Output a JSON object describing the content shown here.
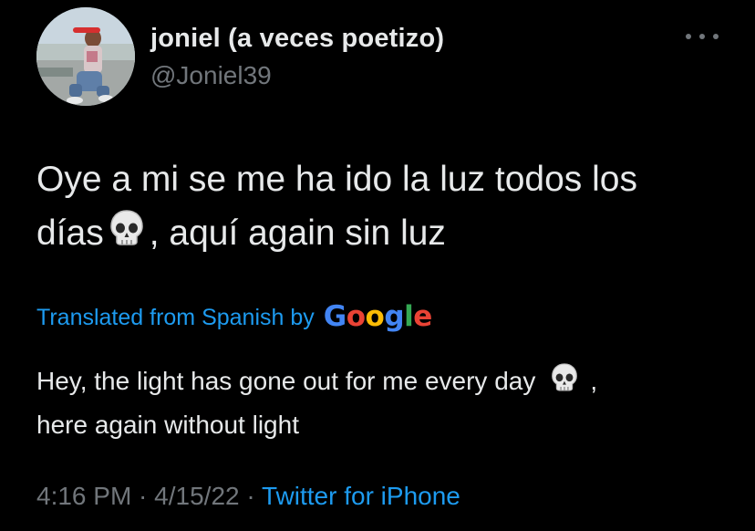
{
  "user": {
    "display_name": "joniel (a veces poetizo)",
    "handle": "@Joniel39"
  },
  "tweet": {
    "text_line1": "Oye a mi se me ha ido la luz todos los",
    "text_line2_a": "días",
    "text_line2_b": ", aquí again sin luz"
  },
  "translation_bar": {
    "label": "Translated from Spanish by",
    "provider": [
      "G",
      "o",
      "o",
      "g",
      "l",
      "e"
    ]
  },
  "translation": {
    "line1_a": "Hey, the light has gone out for me every day",
    "line1_b": ",",
    "line2": "here again without light"
  },
  "meta": {
    "time": "4:16 PM",
    "sep1": " · ",
    "date": "4/15/22",
    "sep2": " · ",
    "source": "Twitter for iPhone"
  },
  "icons": {
    "more": "more-dots-icon",
    "emoji": "skull-emoji-icon"
  },
  "colors": {
    "background": "#000000",
    "primary_text": "#e7e9ea",
    "secondary_text": "#71767b",
    "link": "#1d9bf0",
    "google": [
      "#4285f4",
      "#ea4335",
      "#fbbc05",
      "#4285f4",
      "#34a853",
      "#ea4335"
    ]
  }
}
